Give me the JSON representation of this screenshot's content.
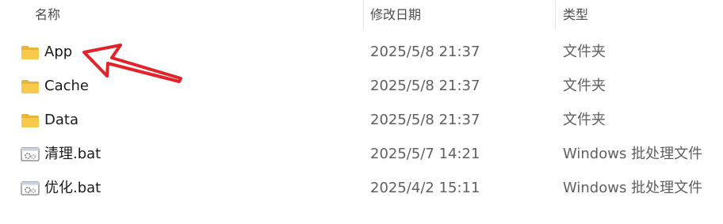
{
  "columns": {
    "name": "名称",
    "modified": "修改日期",
    "type": "类型"
  },
  "files": [
    {
      "name": "App",
      "modified": "2025/5/8 21:37",
      "type": "文件夹",
      "icon": "folder-icon"
    },
    {
      "name": "Cache",
      "modified": "2025/5/8 21:37",
      "type": "文件夹",
      "icon": "folder-icon"
    },
    {
      "name": "Data",
      "modified": "2025/5/8 21:37",
      "type": "文件夹",
      "icon": "folder-icon"
    },
    {
      "name": "清理.bat",
      "modified": "2025/5/7 14:21",
      "type": "Windows 批处理文件",
      "icon": "batch-file-icon"
    },
    {
      "name": "优化.bat",
      "modified": "2025/4/2 15:11",
      "type": "Windows 批处理文件",
      "icon": "batch-file-icon"
    }
  ],
  "colors": {
    "folder": "#f8c94a",
    "annotation_arrow": "#e0242a"
  }
}
